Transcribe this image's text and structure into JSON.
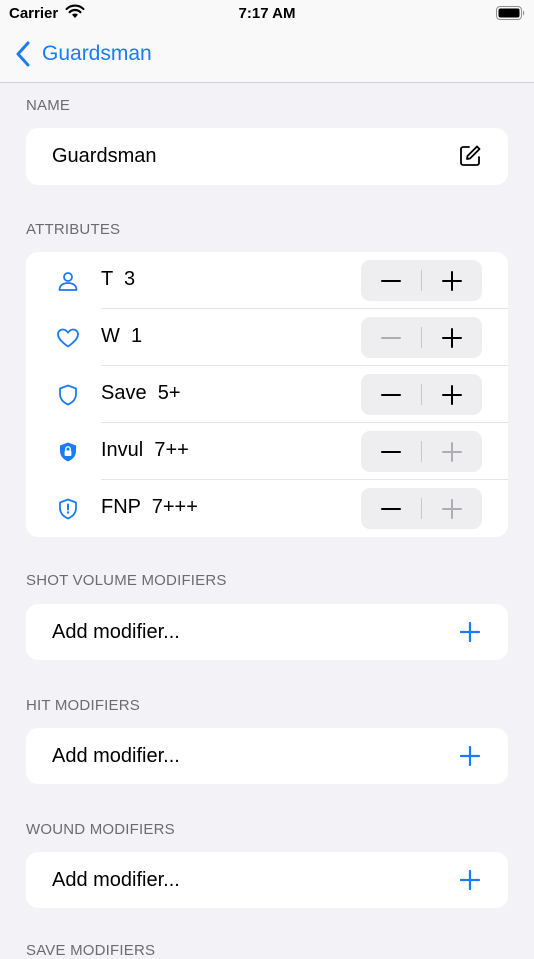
{
  "status_bar": {
    "carrier": "Carrier",
    "time": "7:17 AM"
  },
  "nav": {
    "back_label": "Guardsman"
  },
  "name_section": {
    "header": "NAME",
    "value": "Guardsman"
  },
  "attributes": {
    "header": "ATTRIBUTES",
    "rows": [
      {
        "label": "T  3",
        "icon": "person-icon",
        "minus_enabled": true,
        "plus_enabled": true
      },
      {
        "label": "W  1",
        "icon": "heart-icon",
        "minus_enabled": false,
        "plus_enabled": true
      },
      {
        "label": "Save  5+",
        "icon": "shield-icon",
        "minus_enabled": true,
        "plus_enabled": true
      },
      {
        "label": "Invul  7++",
        "icon": "lock-shield-icon",
        "minus_enabled": true,
        "plus_enabled": false
      },
      {
        "label": "FNP  7+++",
        "icon": "exclamation-shield-icon",
        "minus_enabled": true,
        "plus_enabled": false
      }
    ]
  },
  "shot_volume": {
    "header": "SHOT VOLUME MODIFIERS",
    "add_label": "Add modifier..."
  },
  "hit": {
    "header": "HIT MODIFIERS",
    "add_label": "Add modifier..."
  },
  "wound": {
    "header": "WOUND MODIFIERS",
    "add_label": "Add modifier..."
  },
  "save": {
    "header": "SAVE MODIFIERS"
  },
  "colors": {
    "accent": "#1a7cf5",
    "disabled": "#aeaeb2",
    "background": "#f2f2f7"
  }
}
